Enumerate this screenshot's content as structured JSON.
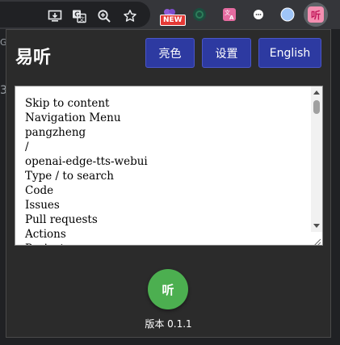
{
  "browser": {
    "toolbar_icons": [
      "install-app-icon",
      "translate-icon",
      "zoom-icon",
      "bookmark-star-icon"
    ],
    "extensions": [
      "grape-extension-icon",
      "green-extension-icon",
      "translate-extension-icon",
      "chat-extension-icon",
      "globe-extension-icon",
      "yiting-extension-icon"
    ],
    "new_badge": "NEW",
    "active_extension_glyph": "听",
    "page_fragment_1": "Gi",
    "page_fragment_2": "3"
  },
  "popup": {
    "title": "易听",
    "buttons": {
      "light": "亮色",
      "settings": "设置",
      "language": "English"
    },
    "textarea_text": "Skip to content\nNavigation Menu\npangzheng\n/\nopenai-edge-tts-webui\nType / to search\nCode\nIssues\nPull requests\nActions\nProjects",
    "listen_button": "听",
    "version": "版本 0.1.1"
  },
  "colors": {
    "toolbar_bg": "#35363a",
    "popup_bg": "#2b2b2b",
    "button_bg": "#2d3aa1",
    "listen_green": "#4caf50",
    "badge_red": "#e53935"
  }
}
